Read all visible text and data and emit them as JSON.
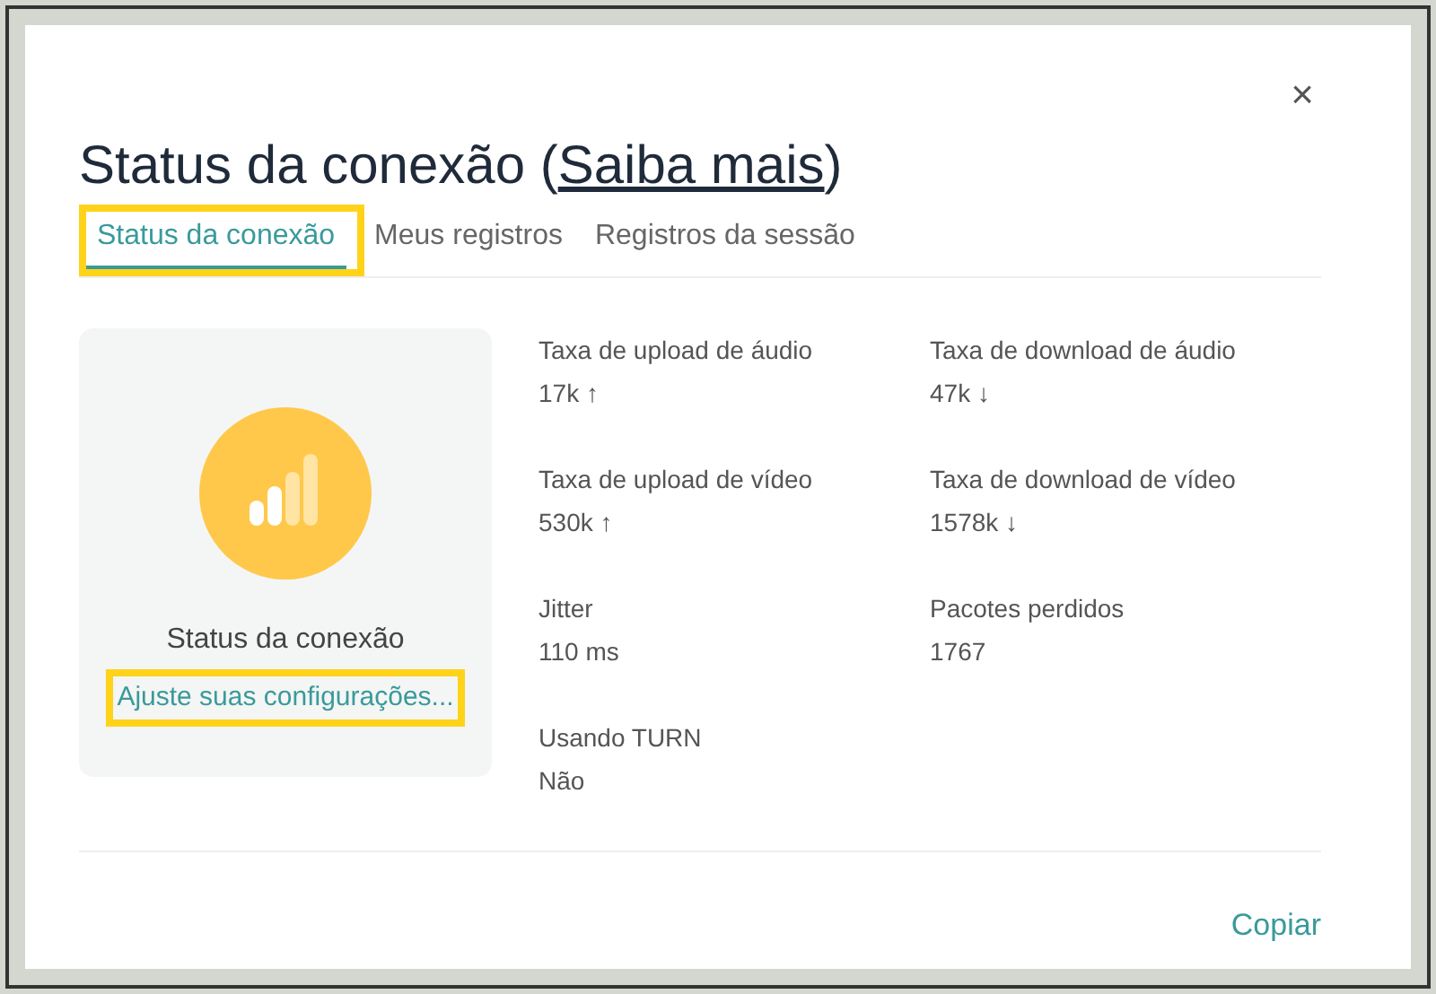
{
  "dialog": {
    "title": {
      "text": "Status da conexão (",
      "link": "Saiba mais",
      "suffix": ")"
    },
    "close": "×"
  },
  "tabs": [
    {
      "label": "Status da conexão",
      "selected": true,
      "highlighted": true
    },
    {
      "label": "Meus registros",
      "selected": false,
      "highlighted": false
    },
    {
      "label": "Registros da sessão",
      "selected": false,
      "highlighted": false
    }
  ],
  "status_card": {
    "label": "Status da conexão",
    "link": "Ajuste suas configurações...",
    "link_highlighted": true
  },
  "stats": [
    {
      "label": "Taxa de upload de áudio",
      "value": "17k ↑"
    },
    {
      "label": "Taxa de download de áudio",
      "value": "47k ↓"
    },
    {
      "label": "Taxa de upload de vídeo",
      "value": "530k ↑"
    },
    {
      "label": "Taxa de download de vídeo",
      "value": "1578k ↓"
    },
    {
      "label": "Jitter",
      "value": "110 ms"
    },
    {
      "label": "Pacotes perdidos",
      "value": "1767"
    },
    {
      "label": "Usando TURN",
      "value": "Não"
    }
  ],
  "footer": {
    "button": "Copiar"
  }
}
